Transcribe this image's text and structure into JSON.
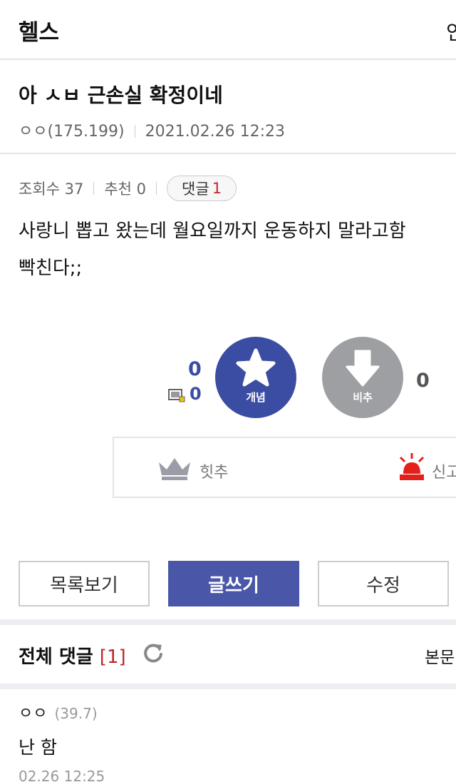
{
  "header": {
    "board_title": "헬스",
    "right_partial": "인"
  },
  "post": {
    "title": "아 ㅅㅂ 근손실 확정이네",
    "author": "ㅇㅇ(175.199)",
    "datetime": "2021.02.26 12:23",
    "views_label": "조회수 37",
    "recommend_label": "추천 0",
    "comment_label": "댓글",
    "comment_count": "1",
    "body_lines": [
      "사랑니 뽑고 왔는데 월요일까지 운동하지 말라고함",
      "빡친다;;"
    ]
  },
  "vote": {
    "up_count": "0",
    "fixed_count": "0",
    "up_label": "개념",
    "down_label": "비추",
    "down_count": "0",
    "up_color": "#3b4ca3",
    "down_color": "#9e9fa3"
  },
  "actions": {
    "hit_label": "힛추",
    "report_partial": "신고"
  },
  "buttons": {
    "list": "목록보기",
    "write": "글쓰기",
    "edit": "수정"
  },
  "comments": {
    "title": "전체 댓글",
    "count": "[1]",
    "right_partial": "본문",
    "items": [
      {
        "nick": "ㅇㅇ",
        "ip": "(39.7)",
        "text": "난 함",
        "date": "02.26 12:25"
      }
    ]
  }
}
